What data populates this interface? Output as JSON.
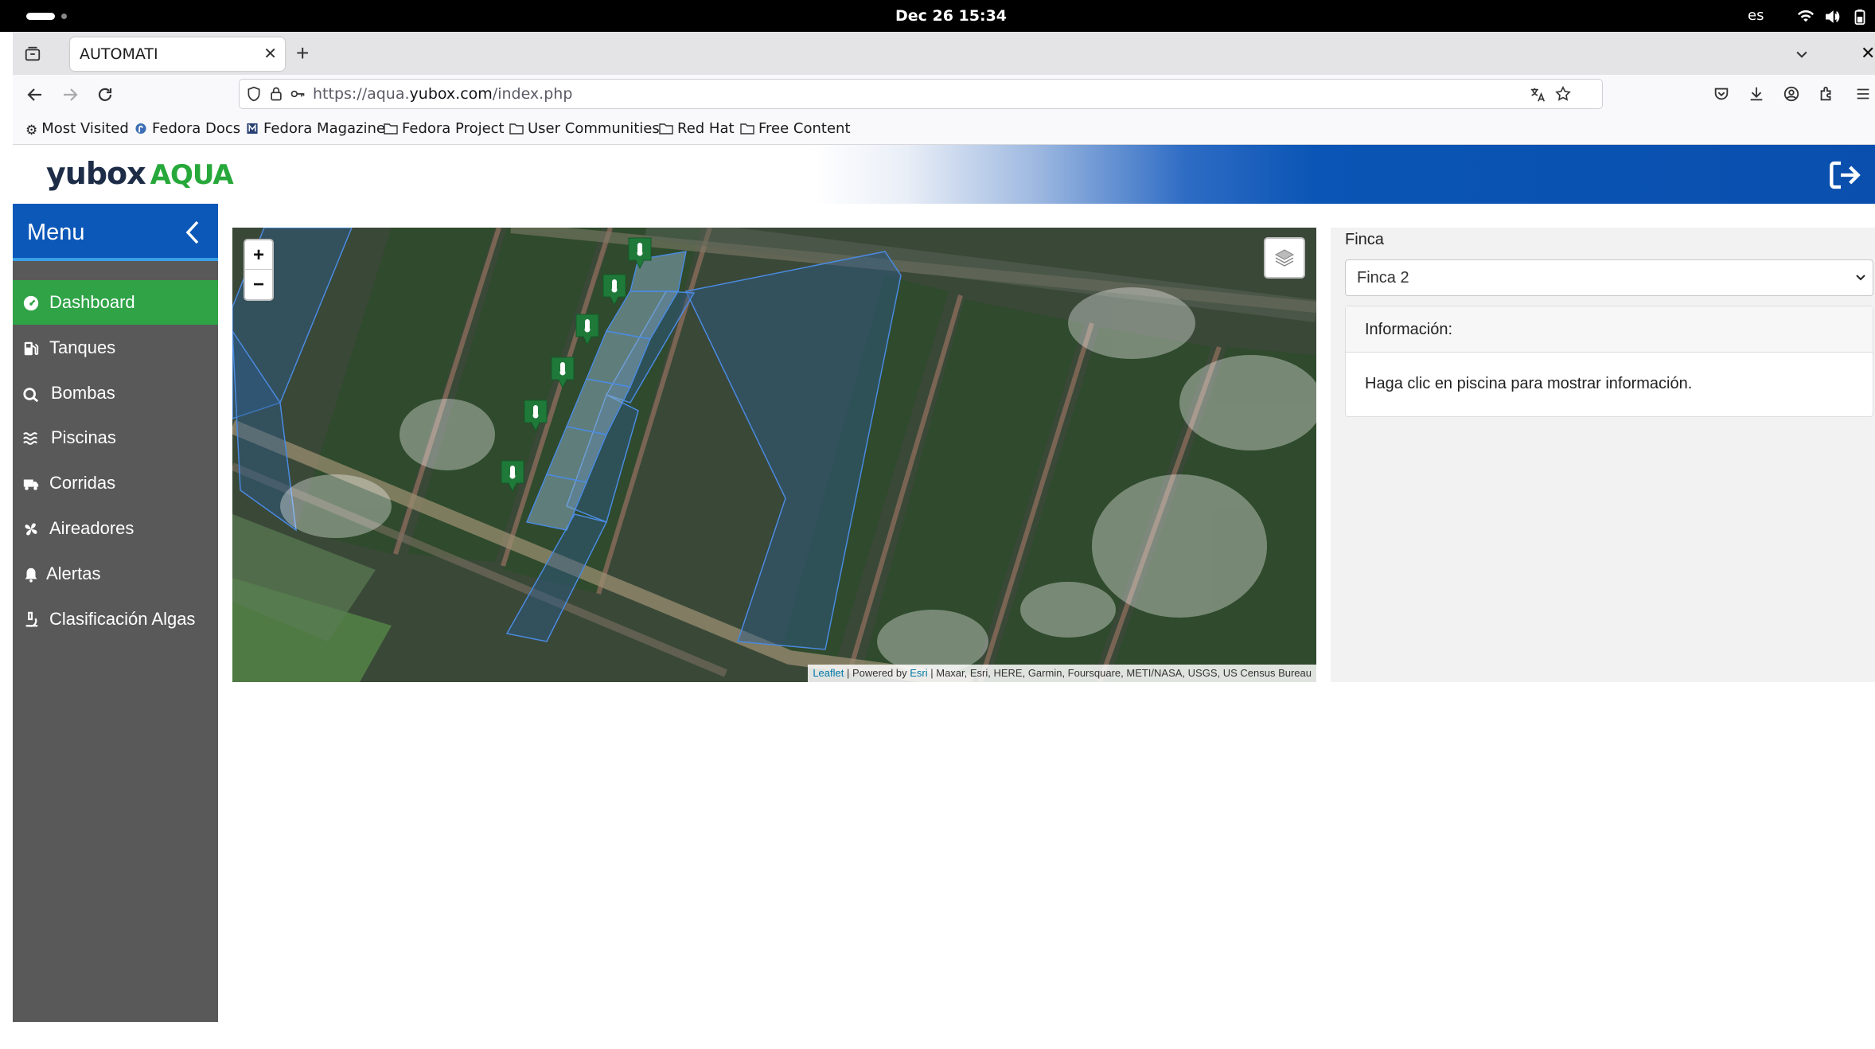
{
  "system_bar": {
    "datetime": "Dec 26  15:34",
    "language": "es"
  },
  "browser": {
    "tab_title": "AUTOMATI",
    "url_prefix": "https://aqua.",
    "url_domain": "yubox.com",
    "url_suffix": "/index.php",
    "bookmarks": [
      "Most Visited",
      "Fedora Docs",
      "Fedora Magazine",
      "Fedora Project",
      "User Communities",
      "Red Hat",
      "Free Content"
    ]
  },
  "app": {
    "logo_word1": "yubox",
    "logo_word2": "AQUA",
    "brand_blue": "#0a55b5",
    "accent_green": "#2fa346"
  },
  "sidebar": {
    "title": "Menu",
    "items": [
      {
        "label": "Dashboard",
        "icon": "gauge-icon",
        "active": true
      },
      {
        "label": "Tanques",
        "icon": "fuel-pump-icon"
      },
      {
        "label": "Bombas",
        "icon": "pump-icon"
      },
      {
        "label": "Piscinas",
        "icon": "water-icon"
      },
      {
        "label": "Corridas",
        "icon": "truck-icon"
      },
      {
        "label": "Aireadores",
        "icon": "fan-icon"
      },
      {
        "label": "Alertas",
        "icon": "bell-icon"
      },
      {
        "label": "Clasificación Algas",
        "icon": "microscope-icon"
      }
    ]
  },
  "map": {
    "zoom_in": "+",
    "zoom_out": "−",
    "attribution_leaflet": "Leaflet",
    "attribution_sep1": " | Powered by ",
    "attribution_esri": "Esri",
    "attribution_rest": " | Maxar, Esri, HERE, Garmin, Foursquare, METI/NASA, USGS, US Census Bureau",
    "marker_count": 6
  },
  "panel": {
    "finca_label": "Finca",
    "finca_selected": "Finca 2",
    "info_header": "Información:",
    "info_body": "Haga clic en piscina para mostrar información."
  }
}
